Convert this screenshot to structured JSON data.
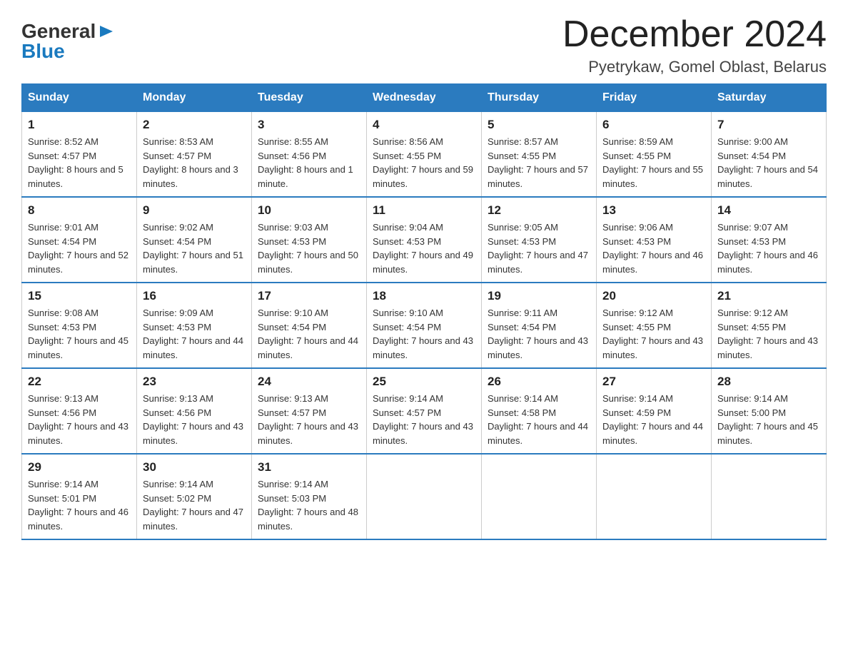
{
  "logo": {
    "general": "General",
    "arrow": "▶",
    "blue": "Blue"
  },
  "title": {
    "month_year": "December 2024",
    "location": "Pyetrykaw, Gomel Oblast, Belarus"
  },
  "days_of_week": [
    "Sunday",
    "Monday",
    "Tuesday",
    "Wednesday",
    "Thursday",
    "Friday",
    "Saturday"
  ],
  "weeks": [
    [
      {
        "day": "1",
        "sunrise": "8:52 AM",
        "sunset": "4:57 PM",
        "daylight": "8 hours and 5 minutes."
      },
      {
        "day": "2",
        "sunrise": "8:53 AM",
        "sunset": "4:57 PM",
        "daylight": "8 hours and 3 minutes."
      },
      {
        "day": "3",
        "sunrise": "8:55 AM",
        "sunset": "4:56 PM",
        "daylight": "8 hours and 1 minute."
      },
      {
        "day": "4",
        "sunrise": "8:56 AM",
        "sunset": "4:55 PM",
        "daylight": "7 hours and 59 minutes."
      },
      {
        "day": "5",
        "sunrise": "8:57 AM",
        "sunset": "4:55 PM",
        "daylight": "7 hours and 57 minutes."
      },
      {
        "day": "6",
        "sunrise": "8:59 AM",
        "sunset": "4:55 PM",
        "daylight": "7 hours and 55 minutes."
      },
      {
        "day": "7",
        "sunrise": "9:00 AM",
        "sunset": "4:54 PM",
        "daylight": "7 hours and 54 minutes."
      }
    ],
    [
      {
        "day": "8",
        "sunrise": "9:01 AM",
        "sunset": "4:54 PM",
        "daylight": "7 hours and 52 minutes."
      },
      {
        "day": "9",
        "sunrise": "9:02 AM",
        "sunset": "4:54 PM",
        "daylight": "7 hours and 51 minutes."
      },
      {
        "day": "10",
        "sunrise": "9:03 AM",
        "sunset": "4:53 PM",
        "daylight": "7 hours and 50 minutes."
      },
      {
        "day": "11",
        "sunrise": "9:04 AM",
        "sunset": "4:53 PM",
        "daylight": "7 hours and 49 minutes."
      },
      {
        "day": "12",
        "sunrise": "9:05 AM",
        "sunset": "4:53 PM",
        "daylight": "7 hours and 47 minutes."
      },
      {
        "day": "13",
        "sunrise": "9:06 AM",
        "sunset": "4:53 PM",
        "daylight": "7 hours and 46 minutes."
      },
      {
        "day": "14",
        "sunrise": "9:07 AM",
        "sunset": "4:53 PM",
        "daylight": "7 hours and 46 minutes."
      }
    ],
    [
      {
        "day": "15",
        "sunrise": "9:08 AM",
        "sunset": "4:53 PM",
        "daylight": "7 hours and 45 minutes."
      },
      {
        "day": "16",
        "sunrise": "9:09 AM",
        "sunset": "4:53 PM",
        "daylight": "7 hours and 44 minutes."
      },
      {
        "day": "17",
        "sunrise": "9:10 AM",
        "sunset": "4:54 PM",
        "daylight": "7 hours and 44 minutes."
      },
      {
        "day": "18",
        "sunrise": "9:10 AM",
        "sunset": "4:54 PM",
        "daylight": "7 hours and 43 minutes."
      },
      {
        "day": "19",
        "sunrise": "9:11 AM",
        "sunset": "4:54 PM",
        "daylight": "7 hours and 43 minutes."
      },
      {
        "day": "20",
        "sunrise": "9:12 AM",
        "sunset": "4:55 PM",
        "daylight": "7 hours and 43 minutes."
      },
      {
        "day": "21",
        "sunrise": "9:12 AM",
        "sunset": "4:55 PM",
        "daylight": "7 hours and 43 minutes."
      }
    ],
    [
      {
        "day": "22",
        "sunrise": "9:13 AM",
        "sunset": "4:56 PM",
        "daylight": "7 hours and 43 minutes."
      },
      {
        "day": "23",
        "sunrise": "9:13 AM",
        "sunset": "4:56 PM",
        "daylight": "7 hours and 43 minutes."
      },
      {
        "day": "24",
        "sunrise": "9:13 AM",
        "sunset": "4:57 PM",
        "daylight": "7 hours and 43 minutes."
      },
      {
        "day": "25",
        "sunrise": "9:14 AM",
        "sunset": "4:57 PM",
        "daylight": "7 hours and 43 minutes."
      },
      {
        "day": "26",
        "sunrise": "9:14 AM",
        "sunset": "4:58 PM",
        "daylight": "7 hours and 44 minutes."
      },
      {
        "day": "27",
        "sunrise": "9:14 AM",
        "sunset": "4:59 PM",
        "daylight": "7 hours and 44 minutes."
      },
      {
        "day": "28",
        "sunrise": "9:14 AM",
        "sunset": "5:00 PM",
        "daylight": "7 hours and 45 minutes."
      }
    ],
    [
      {
        "day": "29",
        "sunrise": "9:14 AM",
        "sunset": "5:01 PM",
        "daylight": "7 hours and 46 minutes."
      },
      {
        "day": "30",
        "sunrise": "9:14 AM",
        "sunset": "5:02 PM",
        "daylight": "7 hours and 47 minutes."
      },
      {
        "day": "31",
        "sunrise": "9:14 AM",
        "sunset": "5:03 PM",
        "daylight": "7 hours and 48 minutes."
      },
      null,
      null,
      null,
      null
    ]
  ]
}
